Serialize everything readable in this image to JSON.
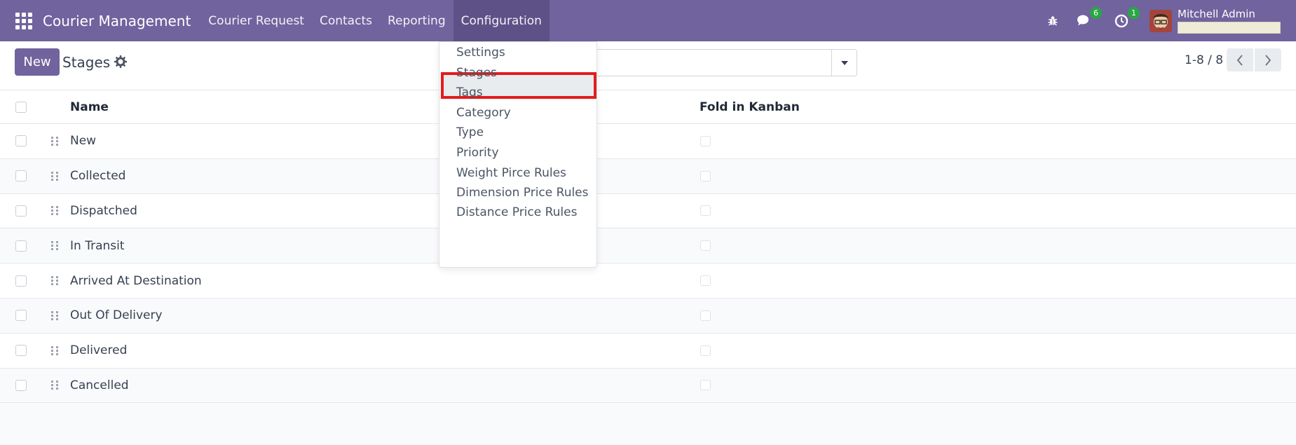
{
  "navbar": {
    "app_name": "Courier Management",
    "menus": [
      "Courier Request",
      "Contacts",
      "Reporting",
      "Configuration"
    ],
    "active_menu": "Configuration",
    "messages_count": "6",
    "activities_count": "1",
    "user_name": "Mitchell Admin",
    "accent": "#71639e"
  },
  "control_panel": {
    "new_label": "New",
    "title": "Stages",
    "pager": "1-8 / 8"
  },
  "table": {
    "columns": [
      "Name",
      "Fold in Kanban"
    ],
    "rows": [
      "New",
      "Collected",
      "Dispatched",
      "In Transit",
      "Arrived At Destination",
      "Out Of Delivery",
      "Delivered",
      "Cancelled"
    ]
  },
  "config_menu": {
    "items": [
      "Settings",
      "Stages",
      "Tags",
      "Category",
      "Type",
      "Priority",
      "Weight Pirce Rules",
      "Dimension Price Rules",
      "Distance Price Rules"
    ],
    "highlighted": "Stages"
  }
}
